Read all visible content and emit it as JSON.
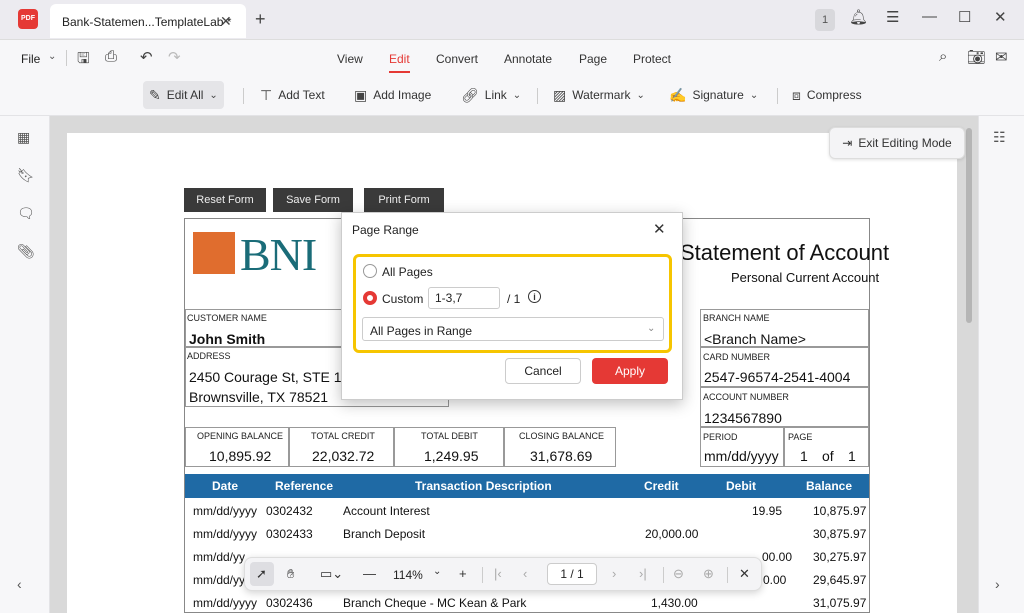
{
  "titlebar": {
    "app_logo": "PDF",
    "tab_title": "Bank-Statemen...TemplateLab *",
    "notification_count": "1"
  },
  "menubar": {
    "file": "File",
    "tabs": [
      "View",
      "Edit",
      "Convert",
      "Annotate",
      "Page",
      "Protect"
    ],
    "active_tab": "Edit"
  },
  "toolbar": {
    "edit_all": "Edit All",
    "add_text": "Add Text",
    "add_image": "Add Image",
    "link": "Link",
    "watermark": "Watermark",
    "signature": "Signature",
    "compress": "Compress"
  },
  "exit_editing": "Exit Editing Mode",
  "form_buttons": {
    "reset": "Reset Form",
    "save": "Save Form",
    "print": "Print Form"
  },
  "document": {
    "bank_name": "BNI",
    "title": "Statement of Account",
    "subtitle": "Personal Current Account",
    "customer_name_label": "CUSTOMER NAME",
    "customer_name": "John Smith",
    "address_label": "ADDRESS",
    "address_line1": "2450 Courage St, STE 108",
    "address_line2": "Brownsville, TX 78521",
    "branch_name_label": "BRANCH NAME",
    "branch_name": "<Branch Name>",
    "card_number_label": "CARD NUMBER",
    "card_number": "2547-96574-2541-4004",
    "account_number_label": "ACCOUNT NUMBER",
    "account_number": "1234567890",
    "period_label": "PERIOD",
    "period": "mm/dd/yyyy",
    "page_label": "PAGE",
    "page_current": "1",
    "page_of": "of",
    "page_total": "1",
    "summary": [
      {
        "label": "OPENING BALANCE",
        "value": "10,895.92"
      },
      {
        "label": "TOTAL CREDIT",
        "value": "22,032.72"
      },
      {
        "label": "TOTAL DEBIT",
        "value": "1,249.95"
      },
      {
        "label": "CLOSING BALANCE",
        "value": "31,678.69"
      }
    ],
    "table_headers": [
      "Date",
      "Reference",
      "Transaction Description",
      "Credit",
      "Debit",
      "Balance"
    ],
    "rows": [
      {
        "date": "mm/dd/yyyy",
        "ref": "0302432",
        "desc": "Account Interest",
        "credit": "",
        "debit": "19.95",
        "balance": "10,875.97"
      },
      {
        "date": "mm/dd/yyyy",
        "ref": "0302433",
        "desc": "Branch Deposit",
        "credit": "20,000.00",
        "debit": "",
        "balance": "30,875.97"
      },
      {
        "date": "mm/dd/yy",
        "ref": "",
        "desc": "",
        "credit": "",
        "debit": "00.00",
        "balance": "30,275.97"
      },
      {
        "date": "mm/dd/yy",
        "ref": "",
        "desc": "",
        "credit": "",
        "debit": "0.00",
        "balance": "29,645.97"
      },
      {
        "date": "mm/dd/yyyy",
        "ref": "0302436",
        "desc": "Branch Cheque - MC Kean & Park",
        "credit": "1,430.00",
        "debit": "",
        "balance": "31,075.97"
      }
    ]
  },
  "dialog": {
    "title": "Page Range",
    "option_all": "All Pages",
    "option_custom": "Custom",
    "custom_value": "1-3,7",
    "of_total": "/ 1",
    "subset_select": "All Pages in Range",
    "cancel": "Cancel",
    "apply": "Apply"
  },
  "float_bar": {
    "zoom": "114%",
    "page_indicator": "1 / 1"
  },
  "colors": {
    "accent": "#e53935",
    "highlight": "#f6c500",
    "table_header": "#1f6aa5"
  }
}
